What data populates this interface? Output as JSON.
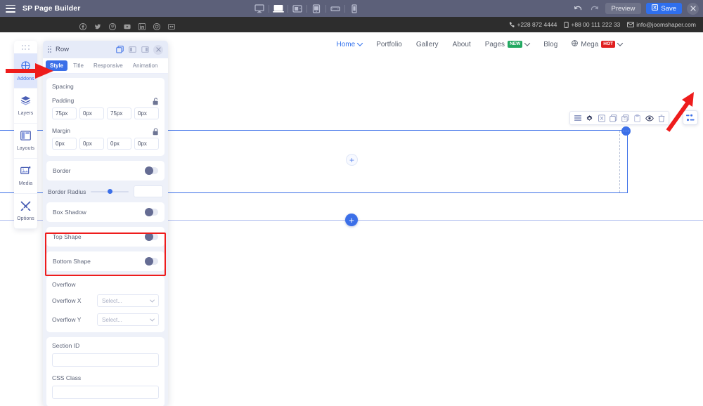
{
  "topbar": {
    "menu_icon": "hamburger-icon",
    "app_title": "SP Page Builder",
    "devices": [
      {
        "name": "desktop",
        "label": "Desktop",
        "active": false
      },
      {
        "name": "laptop",
        "label": "Laptop",
        "active": true
      },
      {
        "name": "tablet-landscape",
        "label": "Tablet Landscape",
        "active": false
      },
      {
        "name": "tablet-portrait",
        "label": "Tablet Portrait",
        "active": false
      },
      {
        "name": "mobile-landscape",
        "label": "Mobile Landscape",
        "active": false
      },
      {
        "name": "mobile-portrait",
        "label": "Mobile Portrait",
        "active": false
      }
    ],
    "undo_icon": "undo-icon",
    "redo_icon": "redo-icon",
    "preview_label": "Preview",
    "save_label": "Save",
    "save_icon": "save-icon",
    "close_icon": "close-icon",
    "accent": "#2f6fed",
    "background": "#5c6079"
  },
  "contactbar": {
    "background": "#2d2d2d",
    "socials": [
      "facebook-icon",
      "twitter-icon",
      "pinterest-icon",
      "youtube-icon",
      "linkedin-icon",
      "instagram-icon",
      "flickr-icon"
    ],
    "items": [
      {
        "icon": "phone-icon",
        "text": "+228 872 4444"
      },
      {
        "icon": "mobile-icon",
        "text": "+88 00 111 222 33"
      },
      {
        "icon": "envelope-icon",
        "text": "info@joomshaper.com"
      }
    ]
  },
  "sitenav": {
    "items": [
      {
        "label": "Home",
        "active": true,
        "chevron": true,
        "badge": null
      },
      {
        "label": "Portfolio",
        "active": false,
        "chevron": false,
        "badge": null
      },
      {
        "label": "Gallery",
        "active": false,
        "chevron": false,
        "badge": null
      },
      {
        "label": "About",
        "active": false,
        "chevron": false,
        "badge": null
      },
      {
        "label": "Pages",
        "active": false,
        "chevron": true,
        "badge": "NEW",
        "badge_type": "new"
      },
      {
        "label": "Blog",
        "active": false,
        "chevron": false,
        "badge": null
      },
      {
        "label": "Mega",
        "active": false,
        "chevron": true,
        "badge": "HOT",
        "badge_type": "hot",
        "icon": "mega-icon"
      }
    ],
    "active_color": "#2f6fed",
    "badge_new_color": "#22a861",
    "badge_hot_color": "#e02020"
  },
  "canvas": {
    "row_toolbar": [
      "rows-icon",
      "gear-icon",
      "save-row-icon",
      "duplicate-icon",
      "copy-icon",
      "paste-icon",
      "eye-icon",
      "trash-icon"
    ],
    "column_settings_icon": "column-layout-icon",
    "row_handle_icon": "row-drag-handle",
    "add_column_icon": "plus-icon",
    "add_row_icon": "plus-icon",
    "selection_color": "#3b6fe8"
  },
  "sidebar": {
    "grip": "drag-grip-icon",
    "items": [
      {
        "label": "Addons",
        "icon": "addons-icon",
        "active": true
      },
      {
        "label": "Layers",
        "icon": "layers-icon",
        "active": false
      },
      {
        "label": "Layouts",
        "icon": "layouts-icon",
        "active": false
      },
      {
        "label": "Media",
        "icon": "media-icon",
        "active": false
      },
      {
        "label": "Options",
        "icon": "options-icon",
        "active": false
      }
    ]
  },
  "panel": {
    "title": "Row",
    "grip_icon": "drag-grip-icon",
    "header_icons": [
      "duplicate-panel-icon",
      "panel-dock-left-icon",
      "panel-dock-right-icon"
    ],
    "close_icon": "close-icon",
    "tabs": [
      {
        "label": "Style",
        "active": true
      },
      {
        "label": "Title",
        "active": false
      },
      {
        "label": "Responsive",
        "active": false
      },
      {
        "label": "Animation",
        "active": false
      }
    ],
    "spacing": {
      "title": "Spacing",
      "padding": {
        "label": "Padding",
        "lock_icon": "unlock-icon",
        "locked": false,
        "values": [
          "75px",
          "0px",
          "75px",
          "0px"
        ]
      },
      "margin": {
        "label": "Margin",
        "lock_icon": "lock-icon",
        "locked": true,
        "values": [
          "0px",
          "0px",
          "0px",
          "0px"
        ]
      }
    },
    "border": {
      "label": "Border",
      "toggle": "off"
    },
    "border_radius": {
      "label": "Border Radius",
      "value": "",
      "slider_percent": 45
    },
    "box_shadow": {
      "label": "Box Shadow",
      "toggle": "off"
    },
    "top_shape": {
      "label": "Top Shape",
      "toggle": "off"
    },
    "bottom_shape": {
      "label": "Bottom Shape",
      "toggle": "off"
    },
    "overflow": {
      "title": "Overflow",
      "x": {
        "label": "Overflow X",
        "value": "",
        "placeholder": "Select..."
      },
      "y": {
        "label": "Overflow Y",
        "value": "",
        "placeholder": "Select..."
      }
    },
    "section_id": {
      "label": "Section ID",
      "value": ""
    },
    "css_class": {
      "label": "CSS Class",
      "value": ""
    }
  },
  "annotations": {
    "highlight_color": "#ee1c1c",
    "rect_target": "top-shape and bottom-shape rows",
    "arrow_addons_target": "Addons sidebar item",
    "arrow_column_target": "column settings button"
  }
}
